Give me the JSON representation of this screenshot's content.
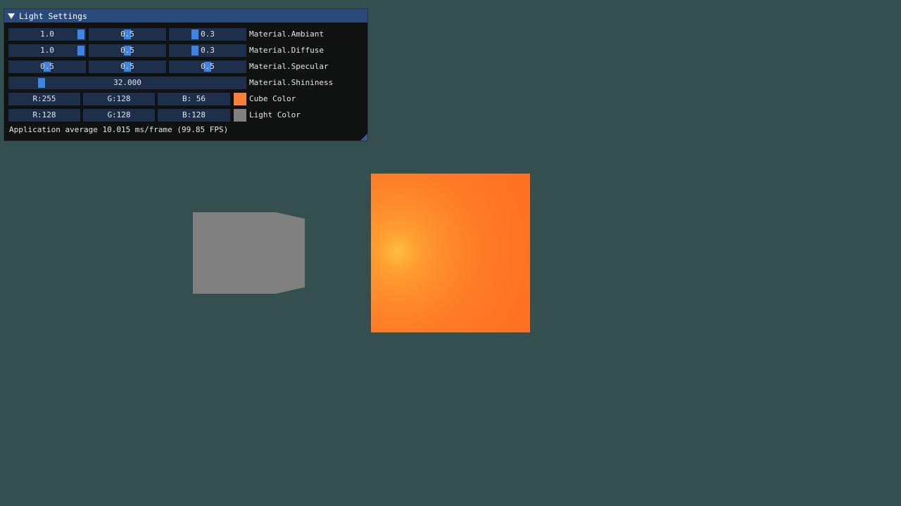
{
  "window": {
    "title": "Light Settings",
    "collapse_icon": "triangle-down-icon"
  },
  "rows": {
    "ambient": {
      "label": "Material.Ambiant",
      "values": [
        "1.0",
        "0.5",
        "0.3"
      ],
      "levels": [
        1.0,
        0.5,
        0.3
      ]
    },
    "diffuse": {
      "label": "Material.Diffuse",
      "values": [
        "1.0",
        "0.5",
        "0.3"
      ],
      "levels": [
        1.0,
        0.5,
        0.3
      ]
    },
    "specular": {
      "label": "Material.Specular",
      "values": [
        "0.5",
        "0.5",
        "0.5"
      ],
      "levels": [
        0.5,
        0.5,
        0.5
      ]
    },
    "shininess": {
      "label": "Material.Shininess",
      "value": "32.000"
    },
    "cube_color": {
      "label": "Cube Color",
      "r": "R:255",
      "g": "G:128",
      "b": "B: 56",
      "swatch": "#ff8038"
    },
    "light_color": {
      "label": "Light Color",
      "r": "R:128",
      "g": "G:128",
      "b": "B:128",
      "swatch": "#808080"
    }
  },
  "status": "Application average 10.015 ms/frame (99.85 FPS)",
  "scene": {
    "background": "#334f4f",
    "light_cube_color": "#808080",
    "lit_cube_color": "#ff7a26"
  }
}
